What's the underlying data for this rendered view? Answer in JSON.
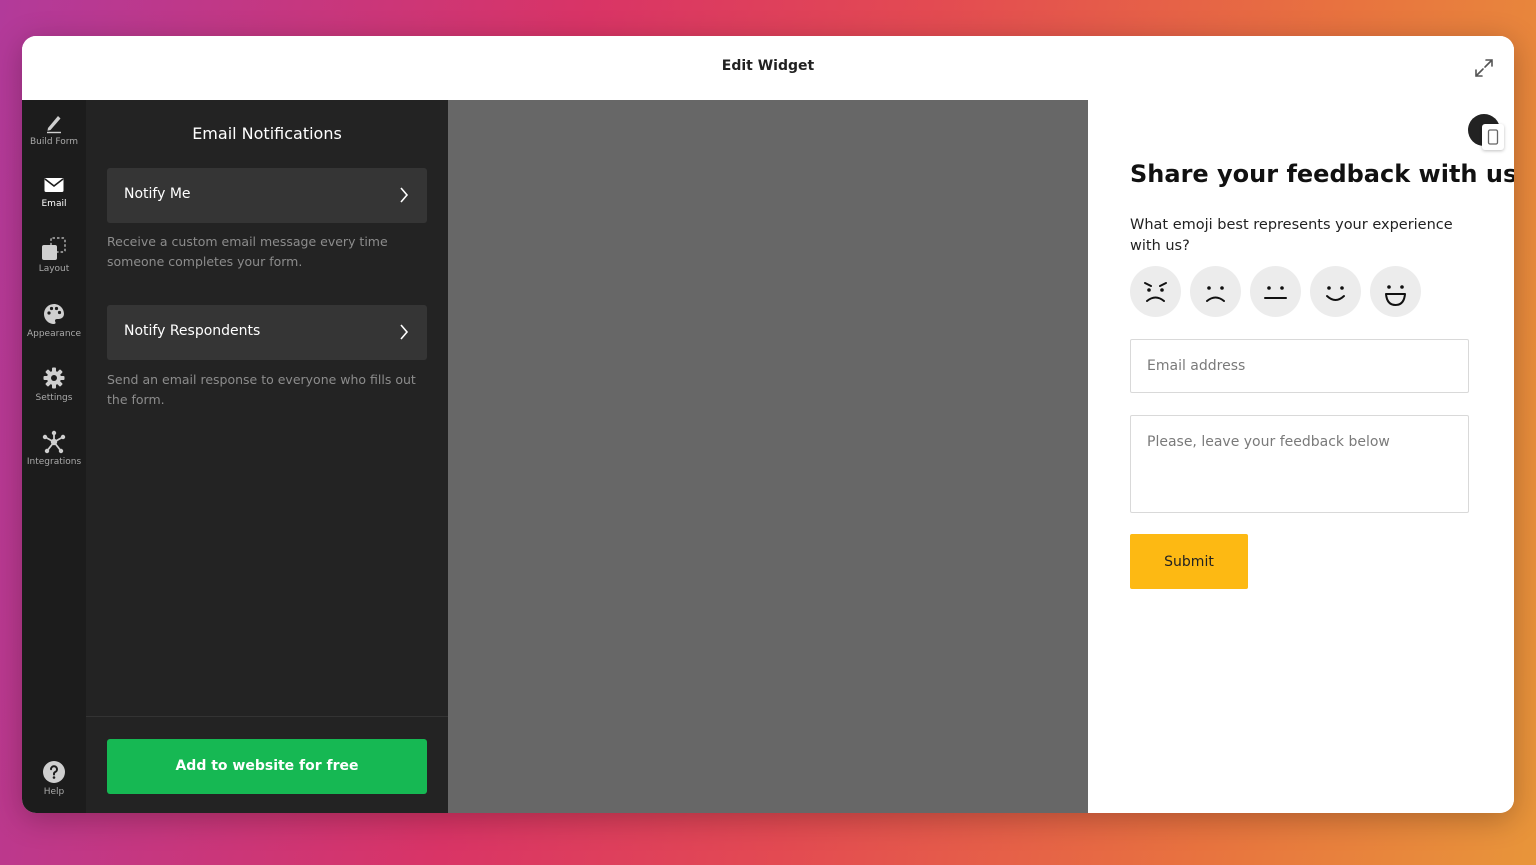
{
  "window": {
    "title": "Edit Widget"
  },
  "rail": [
    {
      "label": "Build Form",
      "icon": "pencil-icon"
    },
    {
      "label": "Email",
      "icon": "envelope-icon",
      "active": true
    },
    {
      "label": "Layout",
      "icon": "layout-icon"
    },
    {
      "label": "Appearance",
      "icon": "palette-icon"
    },
    {
      "label": "Settings",
      "icon": "gear-icon"
    },
    {
      "label": "Integrations",
      "icon": "integrations-icon"
    },
    {
      "label": "Help",
      "icon": "help-icon"
    }
  ],
  "panel": {
    "title": "Email Notifications",
    "options": [
      {
        "label": "Notify Me",
        "description": "Receive a custom email message every time someone completes your form."
      },
      {
        "label": "Notify Respondents",
        "description": "Send an email response to everyone who fills out the form."
      }
    ],
    "cta_label": "Add to website for free"
  },
  "preview": {
    "title": "Share your feedback with us",
    "question": "What emoji best represents your experience with us?",
    "emojis": [
      "angry-face-icon",
      "sad-face-icon",
      "neutral-face-icon",
      "smile-face-icon",
      "grin-face-icon"
    ],
    "email_placeholder": "Email address",
    "feedback_placeholder": "Please, leave your feedback below",
    "submit_label": "Submit"
  },
  "colors": {
    "rail_bg": "#1c1c1c",
    "panel_bg": "#232323",
    "option_bg": "#353535",
    "cta_green": "#16b853",
    "canvas_gray": "#676767",
    "submit_yellow": "#fdb913"
  }
}
